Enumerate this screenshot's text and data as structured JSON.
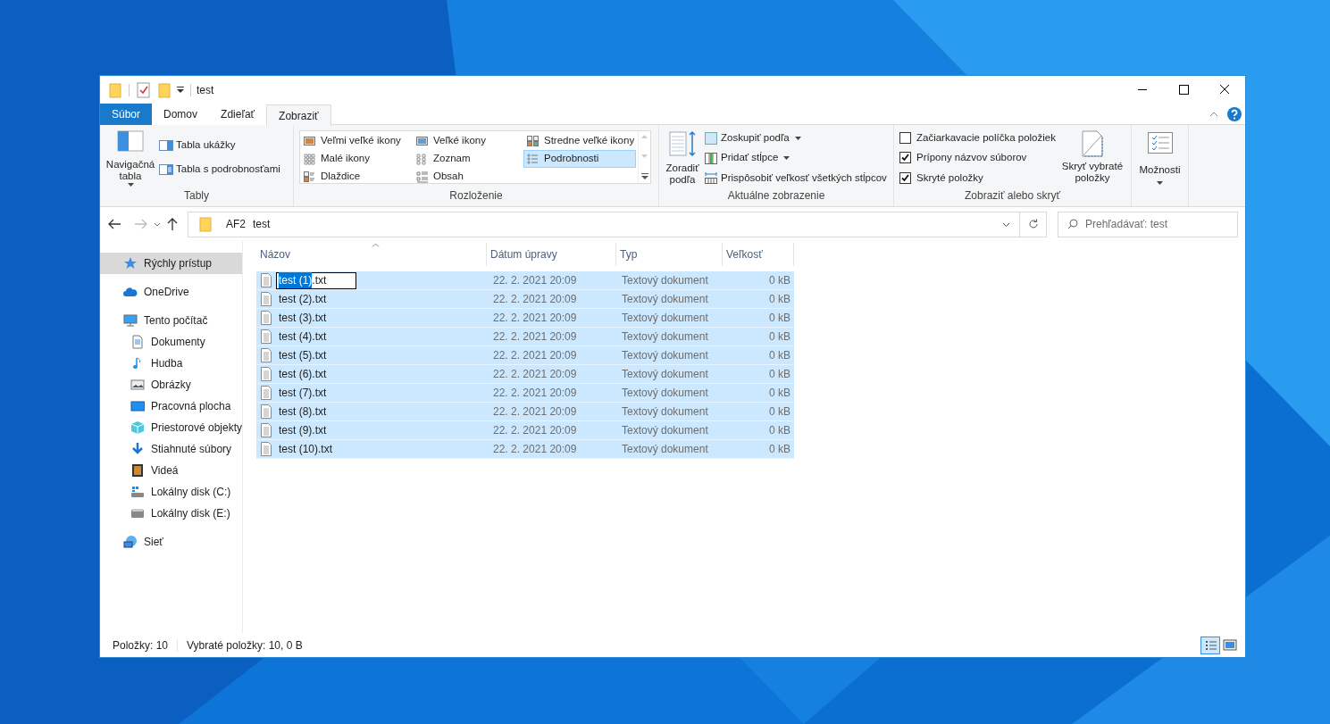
{
  "window": {
    "title": "test"
  },
  "ribbon": {
    "tabs": [
      {
        "label": "Súbor",
        "kind": "file",
        "selected": false
      },
      {
        "label": "Domov",
        "kind": "tab",
        "selected": false
      },
      {
        "label": "Zdieľať",
        "kind": "tab",
        "selected": false
      },
      {
        "label": "Zobraziť",
        "kind": "tab",
        "selected": true
      }
    ],
    "panes": {
      "label": "Tably",
      "large_button": "Navigačná tabla",
      "buttons": [
        "Tabla ukážky",
        "Tabla s podrobnosťami"
      ]
    },
    "layout": {
      "label": "Rozloženie",
      "options": [
        {
          "label": "Veľmi veľké ikony",
          "selected": false
        },
        {
          "label": "Veľké ikony",
          "selected": false
        },
        {
          "label": "Stredne veľké ikony",
          "selected": false
        },
        {
          "label": "Malé ikony",
          "selected": false
        },
        {
          "label": "Zoznam",
          "selected": false
        },
        {
          "label": "Podrobnosti",
          "selected": true
        },
        {
          "label": "Dlaždice",
          "selected": false
        },
        {
          "label": "Obsah",
          "selected": false
        }
      ]
    },
    "current_view": {
      "label": "Aktuálne zobrazenie",
      "sort_button": "Zoradiť podľa",
      "buttons": [
        {
          "label": "Zoskupiť podľa",
          "dropdown": true
        },
        {
          "label": "Pridať stĺpce",
          "dropdown": true
        },
        {
          "label": "Prispôsobiť veľkosť všetkých stĺpcov",
          "dropdown": false
        }
      ]
    },
    "show_hide": {
      "label": "Zobraziť alebo skryť",
      "checkboxes": [
        {
          "label": "Začiarkavacie políčka položiek",
          "checked": false
        },
        {
          "label": "Prípony názvov súborov",
          "checked": true
        },
        {
          "label": "Skryté položky",
          "checked": true
        }
      ],
      "button": "Skryť vybraté položky"
    },
    "options_button": "Možnosti"
  },
  "address": {
    "breadcrumbs": [
      "AF2",
      "test"
    ]
  },
  "search": {
    "placeholder": "Prehľadávať: test"
  },
  "sidebar": {
    "items": [
      {
        "label": "Rýchly prístup",
        "selected": true
      },
      {
        "label": "OneDrive",
        "selected": false
      },
      {
        "label": "Tento počítač",
        "selected": false,
        "children": [
          {
            "label": "Dokumenty",
            "selected": false
          },
          {
            "label": "Hudba",
            "selected": false
          },
          {
            "label": "Obrázky",
            "selected": false
          },
          {
            "label": "Pracovná plocha",
            "selected": false
          },
          {
            "label": "Priestorové objekty",
            "selected": false
          },
          {
            "label": "Stiahnuté súbory",
            "selected": false
          },
          {
            "label": "Videá",
            "selected": false
          },
          {
            "label": "Lokálny disk (C:)",
            "selected": false
          },
          {
            "label": "Lokálny disk (E:)",
            "selected": false
          }
        ]
      },
      {
        "label": "Sieť",
        "selected": false
      }
    ]
  },
  "table": {
    "columns": [
      {
        "label": "Názov",
        "sorted": true
      },
      {
        "label": "Dátum úpravy",
        "sorted": false
      },
      {
        "label": "Typ",
        "sorted": false
      },
      {
        "label": "Veľkosť",
        "sorted": false
      }
    ],
    "rows": [
      {
        "name": "test (1).txt",
        "date": "22. 2. 2021 20:09",
        "type": "Textový dokument",
        "size": "0 kB",
        "selected": true,
        "editing": true
      },
      {
        "name": "test (2).txt",
        "date": "22. 2. 2021 20:09",
        "type": "Textový dokument",
        "size": "0 kB",
        "selected": true,
        "editing": false
      },
      {
        "name": "test (3).txt",
        "date": "22. 2. 2021 20:09",
        "type": "Textový dokument",
        "size": "0 kB",
        "selected": true,
        "editing": false
      },
      {
        "name": "test (4).txt",
        "date": "22. 2. 2021 20:09",
        "type": "Textový dokument",
        "size": "0 kB",
        "selected": true,
        "editing": false
      },
      {
        "name": "test (5).txt",
        "date": "22. 2. 2021 20:09",
        "type": "Textový dokument",
        "size": "0 kB",
        "selected": true,
        "editing": false
      },
      {
        "name": "test (6).txt",
        "date": "22. 2. 2021 20:09",
        "type": "Textový dokument",
        "size": "0 kB",
        "selected": true,
        "editing": false
      },
      {
        "name": "test (7).txt",
        "date": "22. 2. 2021 20:09",
        "type": "Textový dokument",
        "size": "0 kB",
        "selected": true,
        "editing": false
      },
      {
        "name": "test (8).txt",
        "date": "22. 2. 2021 20:09",
        "type": "Textový dokument",
        "size": "0 kB",
        "selected": true,
        "editing": false
      },
      {
        "name": "test (9).txt",
        "date": "22. 2. 2021 20:09",
        "type": "Textový dokument",
        "size": "0 kB",
        "selected": true,
        "editing": false
      },
      {
        "name": "test (10).txt",
        "date": "22. 2. 2021 20:09",
        "type": "Textový dokument",
        "size": "0 kB",
        "selected": true,
        "editing": false
      }
    ]
  },
  "status_bar": {
    "items": "Položky: 10",
    "selection": "Vybraté položky: 10, 0 B",
    "views": [
      {
        "kind": "details",
        "selected": true
      },
      {
        "kind": "large_icons",
        "selected": false
      }
    ]
  }
}
